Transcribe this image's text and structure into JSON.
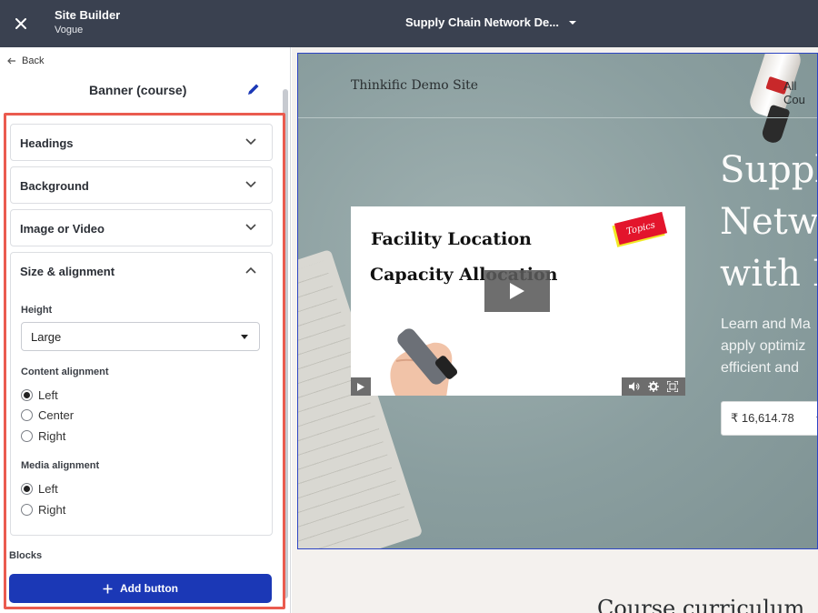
{
  "topbar": {
    "app_title": "Site Builder",
    "theme_name": "Vogue",
    "page_selector": "Supply Chain Network De..."
  },
  "sidebar": {
    "back_label": "Back",
    "panel_title": "Banner (course)",
    "sections": [
      {
        "label": "Headings",
        "expanded": false
      },
      {
        "label": "Background",
        "expanded": false
      },
      {
        "label": "Image or Video",
        "expanded": false
      },
      {
        "label": "Size & alignment",
        "expanded": true
      }
    ],
    "height": {
      "label": "Height",
      "value": "Large"
    },
    "content_alignment": {
      "label": "Content alignment",
      "options": [
        "Left",
        "Center",
        "Right"
      ],
      "selected": "Left"
    },
    "media_alignment": {
      "label": "Media alignment",
      "options": [
        "Left",
        "Right"
      ],
      "selected": "Left"
    },
    "blocks_label": "Blocks",
    "add_button_label": "Add button"
  },
  "preview": {
    "site_name": "Thinkific Demo Site",
    "nav_link": "All Cou",
    "video": {
      "line1": "Facility Location",
      "line2": "Capacity Allocation",
      "tag": "Topics"
    },
    "hero_title_lines": [
      "Suppl",
      "Netwo",
      "with E"
    ],
    "hero_sub_lines": [
      "Learn and Ma",
      "apply optimiz",
      "efficient and"
    ],
    "price": "₹ 16,614.78",
    "curriculum_heading": "Course curriculum"
  },
  "colors": {
    "topbar_bg": "#3a4150",
    "highlight_border": "#ea5b4f",
    "primary_button": "#1b38b6",
    "banner_bg": "#8fa3a4"
  }
}
